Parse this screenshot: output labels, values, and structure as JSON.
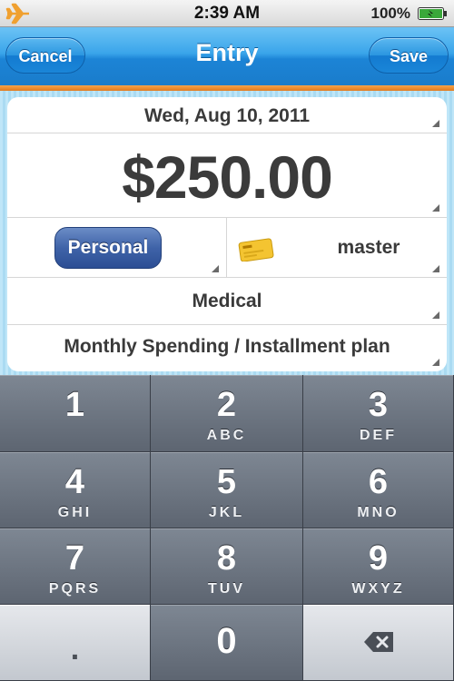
{
  "status_bar": {
    "time": "2:39 AM",
    "battery_percent": "100%",
    "airplane_icon": "airplane-icon",
    "battery_icon": "battery-icon"
  },
  "nav": {
    "title": "Entry",
    "cancel_label": "Cancel",
    "save_label": "Save"
  },
  "form": {
    "date": "Wed, Aug 10, 2011",
    "amount": "$250.00",
    "account_type": "Personal",
    "payment_method": "master",
    "category": "Medical",
    "plan": "Monthly Spending / Installment plan"
  },
  "keypad": {
    "keys": [
      {
        "num": "1",
        "letters": ""
      },
      {
        "num": "2",
        "letters": "ABC"
      },
      {
        "num": "3",
        "letters": "DEF"
      },
      {
        "num": "4",
        "letters": "GHI"
      },
      {
        "num": "5",
        "letters": "JKL"
      },
      {
        "num": "6",
        "letters": "MNO"
      },
      {
        "num": "7",
        "letters": "PQRS"
      },
      {
        "num": "8",
        "letters": "TUV"
      },
      {
        "num": "9",
        "letters": "WXYZ"
      }
    ],
    "decimal": ".",
    "zero": "0",
    "backspace_icon": "backspace-icon"
  },
  "colors": {
    "nav_blue": "#1a86d8",
    "accent_orange": "#e07b1f",
    "pill_blue": "#3f63a8",
    "key_gray": "#5d6571"
  }
}
